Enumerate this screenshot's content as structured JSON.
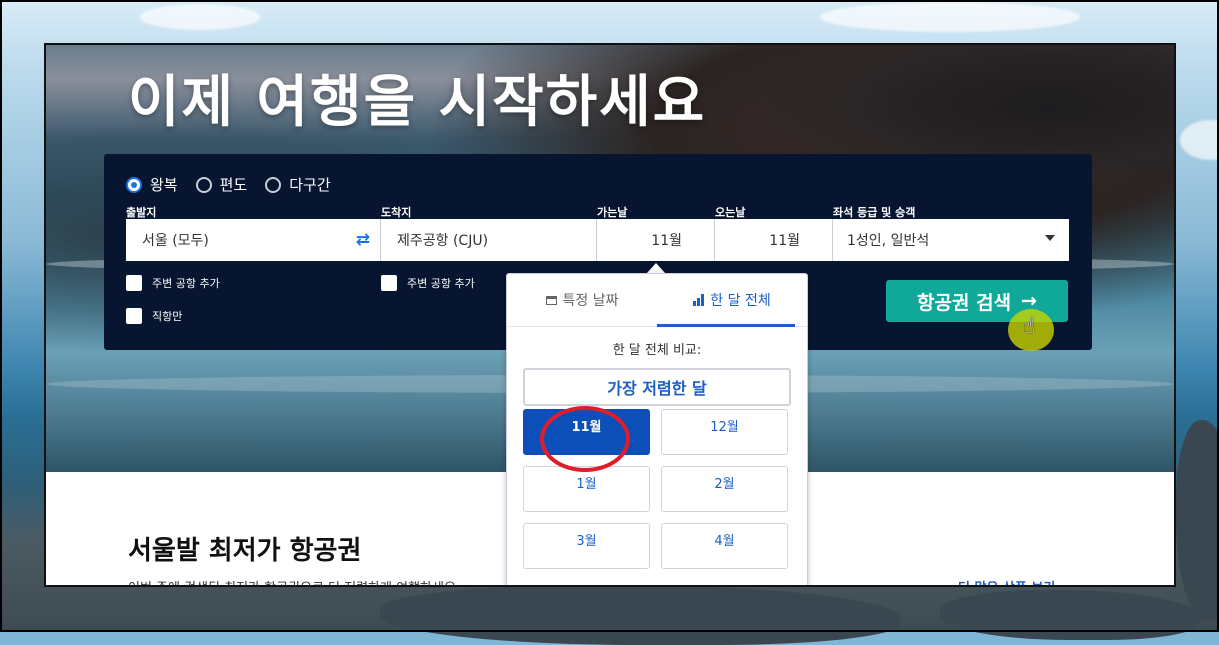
{
  "hero": {
    "title": "이제 여행을 시작하세요"
  },
  "search": {
    "trip_types": [
      {
        "label": "왕복",
        "selected": true
      },
      {
        "label": "편도",
        "selected": false
      },
      {
        "label": "다구간",
        "selected": false
      }
    ],
    "fields": {
      "origin": {
        "label": "출발지",
        "value": "서울 (모두)"
      },
      "destination": {
        "label": "도착지",
        "value": "제주공항 (CJU)"
      },
      "depart": {
        "label": "가는날",
        "value": "11월"
      },
      "return": {
        "label": "오는날",
        "value": "11월"
      },
      "cabin": {
        "label": "좌석 등급 및 승객",
        "value": "1성인, 일반석"
      }
    },
    "checkboxes": {
      "nearby_origin": "주변 공항 추가",
      "nearby_destination": "주변 공항 추가",
      "direct_only": "직항만"
    },
    "search_button": "항공권 검색",
    "search_arrow": "→"
  },
  "date_popup": {
    "tabs": [
      {
        "label": "특정 날짜",
        "active": false
      },
      {
        "label": "한 달 전체",
        "active": true
      }
    ],
    "compare_label": "한 달 전체 비교:",
    "cheapest_button": "가장 저렴한 달",
    "months": [
      {
        "label": "11월",
        "selected": true
      },
      {
        "label": "12월",
        "selected": false
      },
      {
        "label": "1월",
        "selected": false
      },
      {
        "label": "2월",
        "selected": false
      },
      {
        "label": "3월",
        "selected": false
      },
      {
        "label": "4월",
        "selected": false
      }
    ]
  },
  "lower": {
    "title": "서울발 최저가 항공권",
    "subtitle": "이번 주에 검색된 최저가 항공권으로 더 저렴하게 여행하세요",
    "more_link": "더 많은 상품 보기"
  },
  "colors": {
    "panel": "#071530",
    "accent_blue": "#1a5fc9",
    "search_green": "#10a899",
    "annotation_red": "#e01d2a"
  }
}
